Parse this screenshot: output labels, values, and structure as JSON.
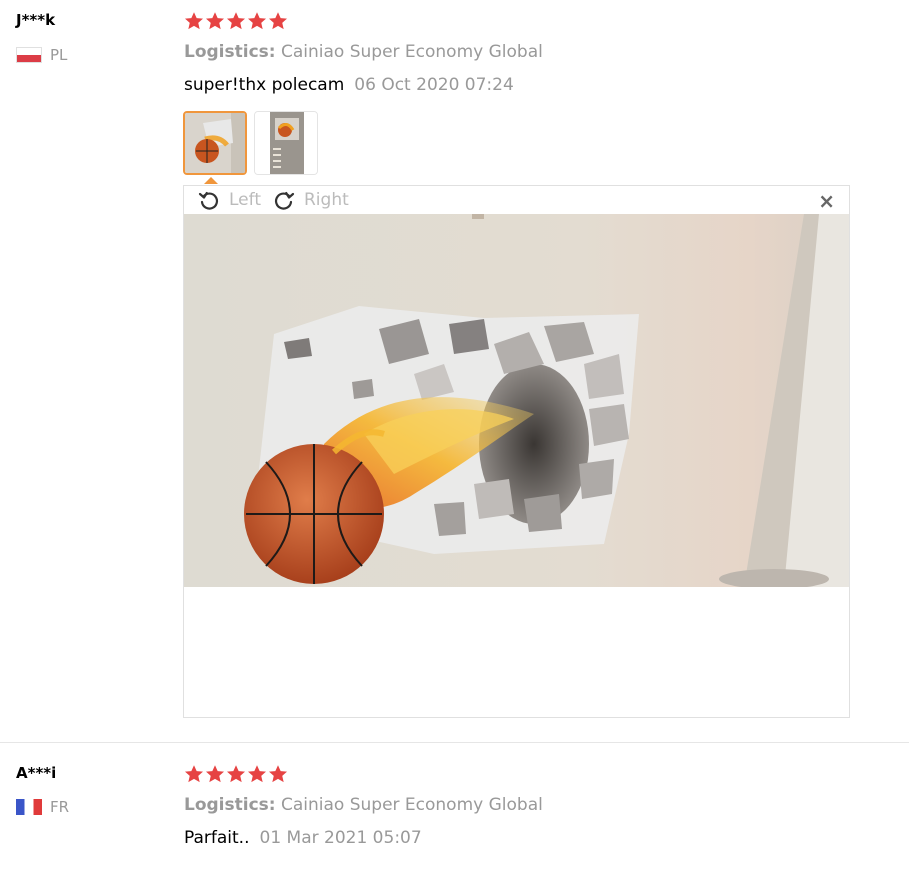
{
  "reviews": [
    {
      "user": "J***k",
      "country": "PL",
      "rating": 5,
      "logistics_label": "Logistics:",
      "logistics_value": "Cainiao Super Economy Global",
      "comment": "super!thx polecam",
      "date": "06 Oct 2020 07:24",
      "thumbnails": 2,
      "viewer": {
        "left_label": "Left",
        "right_label": "Right",
        "close": "×"
      }
    },
    {
      "user": "A***i",
      "country": "FR",
      "rating": 5,
      "logistics_label": "Logistics:",
      "logistics_value": "Cainiao Super Economy Global",
      "comment": "Parfait..",
      "date": "01 Mar 2021 05:07"
    }
  ],
  "colors": {
    "star": "#e64343",
    "accent": "#f0963c",
    "muted": "#999999"
  },
  "icons": {
    "rotate_left": "rotate-left-icon",
    "rotate_right": "rotate-right-icon",
    "close": "close-icon"
  }
}
